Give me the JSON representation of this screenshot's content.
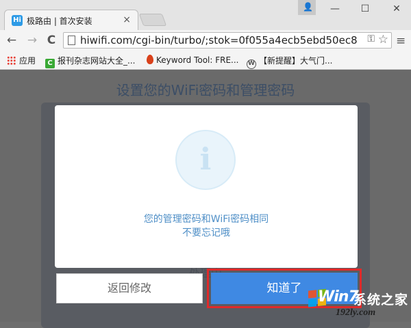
{
  "tab": {
    "title": "极路由 | 首次安装",
    "logo_text": "Hi",
    "close_label": "×"
  },
  "window_controls": {
    "minimize": "—",
    "maximize": "☐",
    "close": "✕"
  },
  "toolbar": {
    "back": "←",
    "forward": "→",
    "reload": "C",
    "url": "hiwifi.com/cgi-bin/turbo/;stok=0f055a4ecb5ebd50ec8",
    "menu": "≡"
  },
  "bookmarks": [
    {
      "label": "应用",
      "icon": "apps-grid-icon"
    },
    {
      "label": "报刊杂志网站大全_...",
      "icon": "green-c-icon",
      "color": "#3aa935"
    },
    {
      "label": "Keyword Tool: FRE...",
      "icon": "flame-icon",
      "color": "#d9411b"
    },
    {
      "label": "【新提醒】大气门...",
      "icon": "wordpress-icon",
      "color": "#555555"
    }
  ],
  "page": {
    "heading": "设置您的WiFi密码和管理密码",
    "hidden_button_text": "处理中"
  },
  "modal": {
    "icon": "i",
    "message_line1": "您的管理密码和WiFi密码相同",
    "message_line2": "不要忘记哦",
    "back_button": "返回修改",
    "ok_button": "知道了"
  },
  "watermark": {
    "win": "Win7",
    "cn": "系统之家",
    "site": "192ly.com"
  },
  "colors": {
    "accent": "#3f89e3",
    "highlight": "#e02a2a",
    "message": "#4f8fc7"
  }
}
